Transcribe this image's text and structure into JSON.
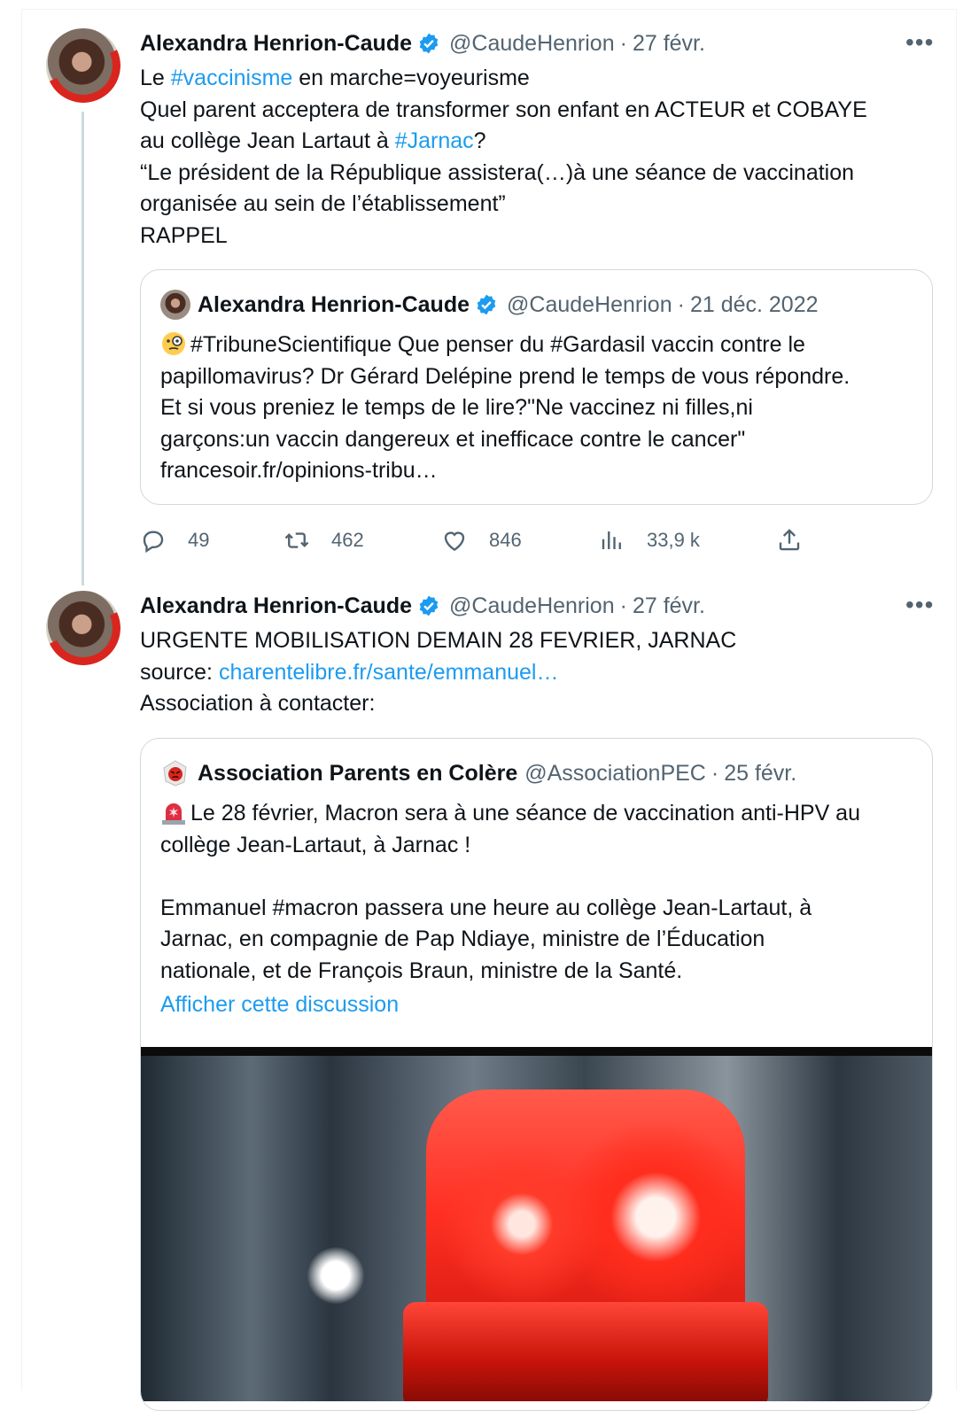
{
  "tweets": [
    {
      "author_name": "Alexandra Henrion-Caude",
      "handle": "@CaudeHenrion",
      "separator": "·",
      "date": "27 févr.",
      "more": "•••",
      "lines": {
        "l1_pre": "Le ",
        "l1_link": "#vaccinisme",
        "l1_post": " en marche=voyeurisme",
        "l2": "Quel parent acceptera de transformer son enfant en ACTEUR et COBAYE",
        "l3_pre": "au collège Jean Lartaut à ",
        "l3_link": "#Jarnac",
        "l3_post": "?",
        "l4": "“Le président de la République assistera(…)à une séance de vaccination",
        "l5": "organisée au sein de l’établissement”",
        "l6": "RAPPEL"
      },
      "quote": {
        "author_name": "Alexandra Henrion-Caude",
        "handle": "@CaudeHenrion",
        "separator": "·",
        "date": "21 déc. 2022",
        "emoji": "monocle-face-emoji",
        "lines": {
          "l1": "#TribuneScientifique Que penser du #Gardasil vaccin contre le",
          "l2": "papillomavirus? Dr Gérard Delépine prend le temps de vous répondre.",
          "l3": "Et si vous preniez le temps de le lire?\"Ne vaccinez ni filles,ni",
          "l4": "garçons:un vaccin dangereux et inefficace contre le cancer\"",
          "l5": "francesoir.fr/opinions-tribu…"
        }
      },
      "actions": {
        "replies": "49",
        "retweets": "462",
        "likes": "846",
        "views": "33,9 k"
      }
    },
    {
      "author_name": "Alexandra Henrion-Caude",
      "handle": "@CaudeHenrion",
      "separator": "·",
      "date": "27 févr.",
      "more": "•••",
      "lines": {
        "l1": "URGENTE MOBILISATION DEMAIN 28 FEVRIER, JARNAC",
        "l2_pre": "source: ",
        "l2_link": "charentelibre.fr/sante/emmanuel…",
        "l3": "Association à contacter:"
      },
      "quote": {
        "author_name": "Association Parents en Colère",
        "handle": "@AssociationPEC",
        "separator": "·",
        "date": "25 févr.",
        "emoji": "rotating-light-emoji",
        "lines": {
          "l1": "Le 28 février, Macron sera à une séance de vaccination anti-HPV au",
          "l2": "collège Jean-Lartaut, à Jarnac !",
          "l3": "Emmanuel #macron passera une heure au collège Jean-Lartaut, à",
          "l4": "Jarnac, en compagnie de Pap Ndiaye, ministre de l’Éducation",
          "l5": "nationale, et de François Braun, ministre de la Santé."
        },
        "show_thread": "Afficher cette discussion"
      }
    }
  ],
  "colors": {
    "link": "#1d9bf0",
    "muted": "#536471",
    "text": "#0f1419",
    "border": "#cfd9de",
    "verified": "#1d9bf0"
  }
}
